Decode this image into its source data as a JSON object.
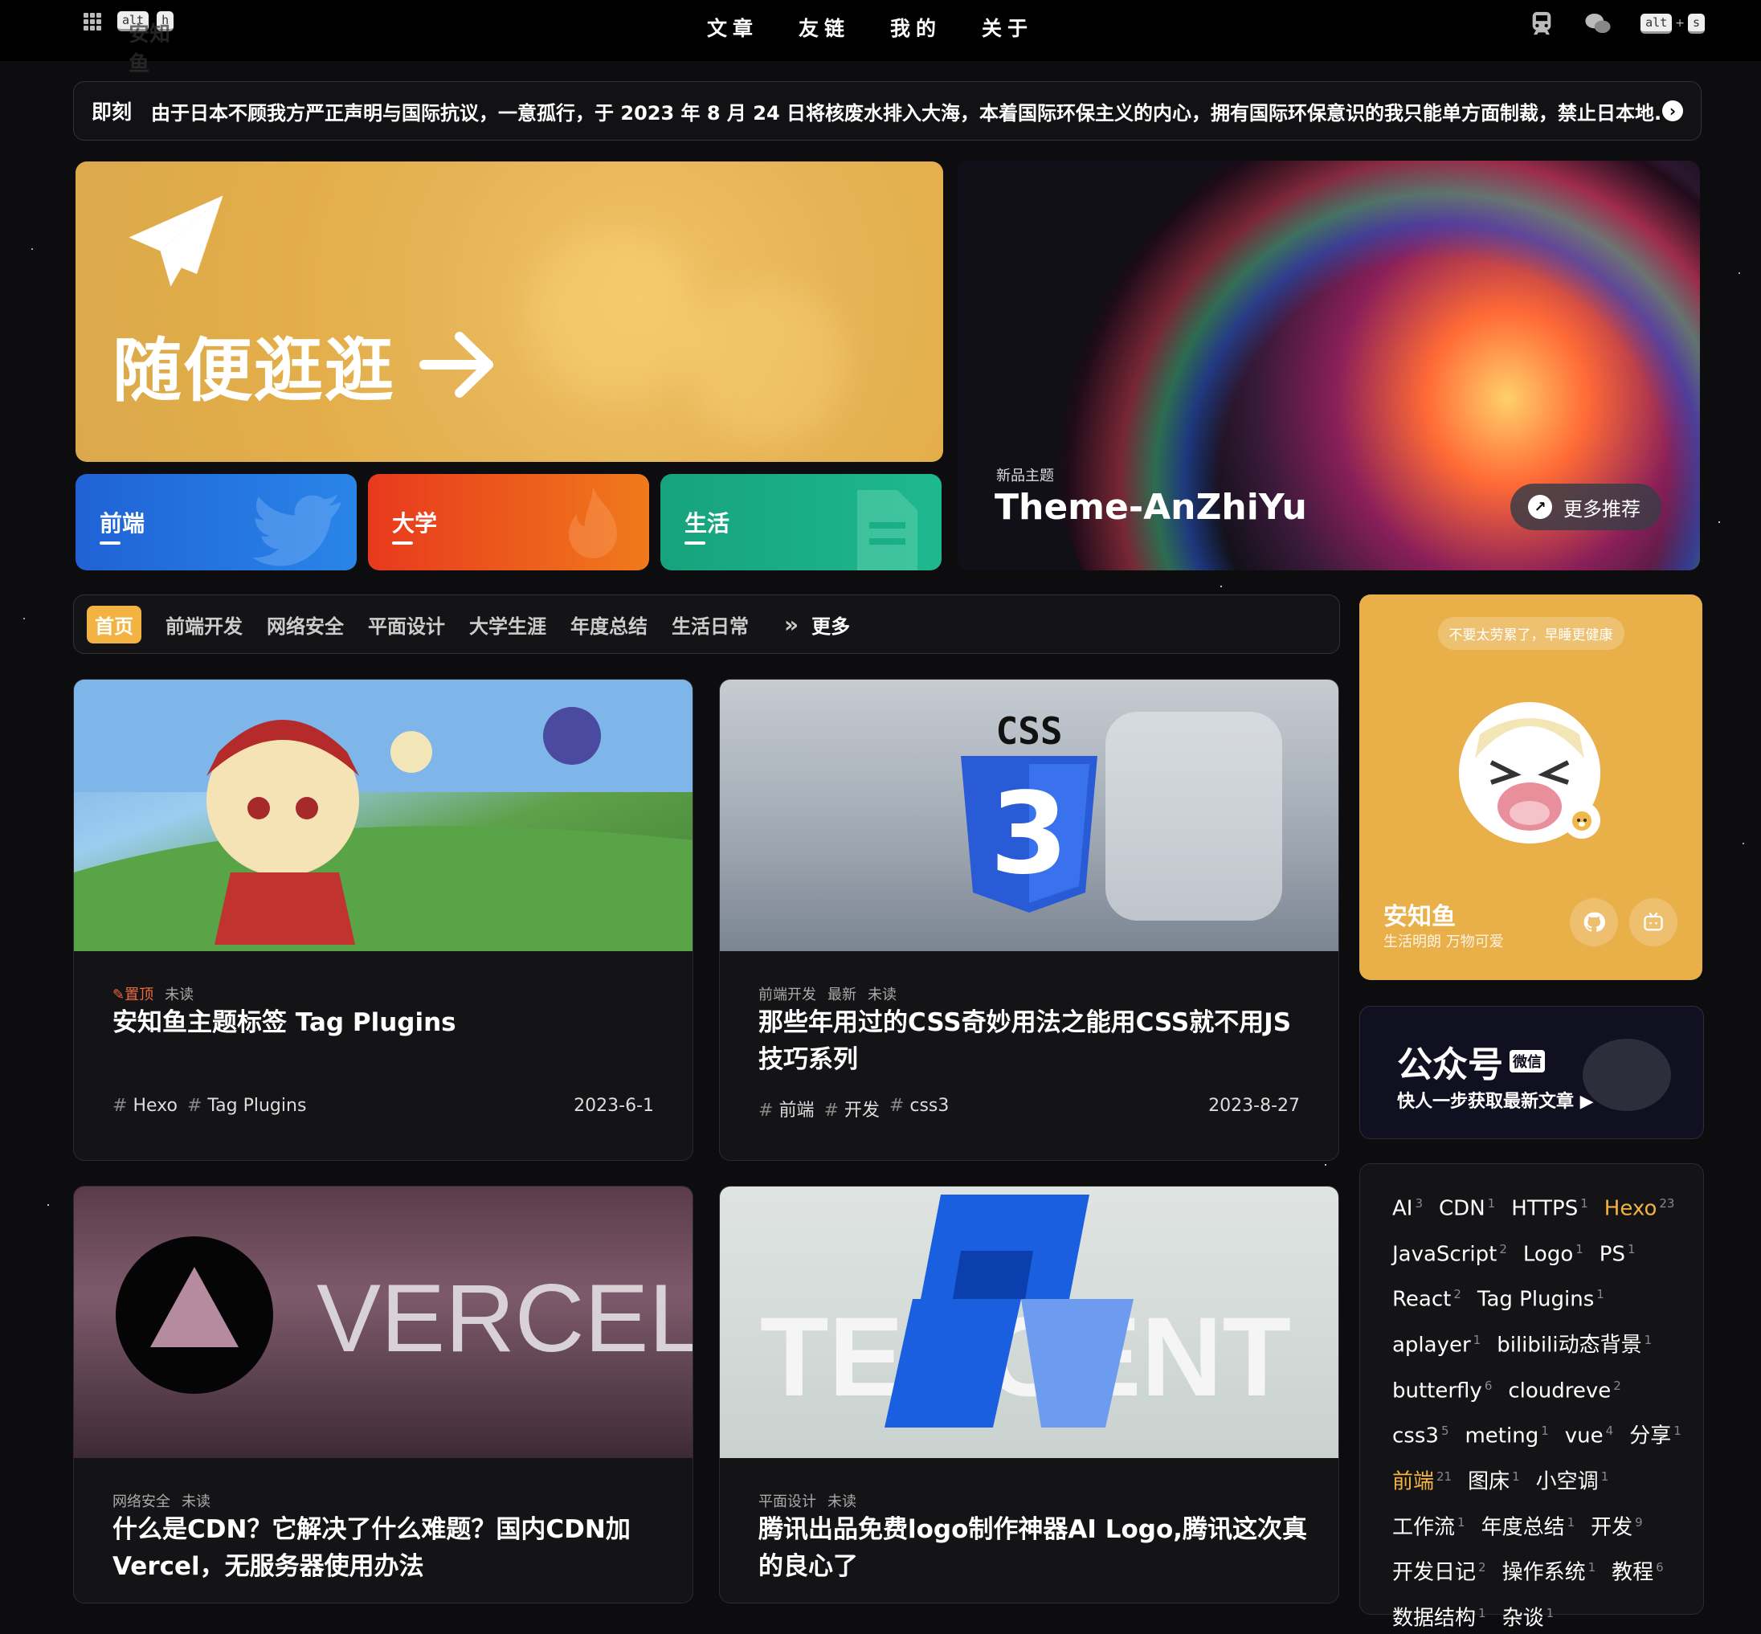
{
  "header": {
    "site_name": "安知鱼",
    "kbd_alt": "alt",
    "kbd_h": "h",
    "kbd_s": "s",
    "kbd_plus": "+",
    "nav": [
      "文章",
      "友链",
      "我的",
      "关于"
    ]
  },
  "bulletin": {
    "label": "即刻",
    "text": "由于日本不顾我方严正声明与国际抗议，一意孤行，于 2023 年 8 月 24 日将核废水排入大海，本着国际环保主义的内心，拥有国际环保意识的我只能单方面制裁，禁止日本地..."
  },
  "random": {
    "label": "随便逛逛"
  },
  "categories_tiles": [
    {
      "label": "前端",
      "color": "#1f62d6"
    },
    {
      "label": "大学",
      "color": "#e8391d"
    },
    {
      "label": "生活",
      "color": "#16a37d"
    }
  ],
  "banner": {
    "subtitle": "新品主题",
    "title": "Theme-AnZhiYu",
    "more_label": "更多推荐"
  },
  "category_bar": {
    "items": [
      "首页",
      "前端开发",
      "网络安全",
      "平面设计",
      "大学生涯",
      "年度总结",
      "生活日常"
    ],
    "more": "更多"
  },
  "posts": [
    {
      "pin": "置顶",
      "meta": [
        "未读"
      ],
      "title": "安知鱼主题标签 Tag Plugins",
      "tags": [
        "Hexo",
        "Tag Plugins"
      ],
      "date": "2023-6-1"
    },
    {
      "meta": [
        "前端开发",
        "最新",
        "未读"
      ],
      "title": "那些年用过的CSS奇妙用法之能用CSS就不用JS技巧系列",
      "tags": [
        "前端",
        "开发",
        "css3"
      ],
      "date": "2023-8-27"
    },
    {
      "meta": [
        "网络安全",
        "未读"
      ],
      "title": "什么是CDN？它解决了什么难题？国内CDN加Vercel，无服务器使用办法"
    },
    {
      "meta": [
        "平面设计",
        "未读"
      ],
      "title": "腾讯出品免费logo制作神器AI Logo,腾讯这次真的良心了"
    }
  ],
  "covers": {
    "css_label": "CSS",
    "css_number": "3",
    "vercel_label": "VERCEL",
    "tencent_label": "TENCENT"
  },
  "author": {
    "tip": "不要太劳累了，早睡更健康",
    "name": "安知鱼",
    "desc": "生活明朗 万物可爱"
  },
  "wechat": {
    "title": "公众号",
    "badge": "微信",
    "subtitle": "快人一步获取最新文章 ▶"
  },
  "tags": [
    {
      "name": "AI",
      "count": "3"
    },
    {
      "name": "CDN",
      "count": "1"
    },
    {
      "name": "HTTPS",
      "count": "1"
    },
    {
      "name": "Hexo",
      "count": "23",
      "highlight": true
    },
    {
      "name": "JavaScript",
      "count": "2"
    },
    {
      "name": "Logo",
      "count": "1"
    },
    {
      "name": "PS",
      "count": "1"
    },
    {
      "name": "React",
      "count": "2"
    },
    {
      "name": "Tag Plugins",
      "count": "1"
    },
    {
      "name": "aplayer",
      "count": "1"
    },
    {
      "name": "bilibili动态背景",
      "count": "1"
    },
    {
      "name": "butterfly",
      "count": "6"
    },
    {
      "name": "cloudreve",
      "count": "2"
    },
    {
      "name": "css3",
      "count": "5"
    },
    {
      "name": "meting",
      "count": "1"
    },
    {
      "name": "vue",
      "count": "4"
    },
    {
      "name": "分享",
      "count": "1"
    },
    {
      "name": "前端",
      "count": "21",
      "highlight": true
    },
    {
      "name": "图床",
      "count": "1"
    },
    {
      "name": "小空调",
      "count": "1"
    },
    {
      "name": "工作流",
      "count": "1"
    },
    {
      "name": "年度总结",
      "count": "1"
    },
    {
      "name": "开发",
      "count": "9"
    },
    {
      "name": "开发日记",
      "count": "2"
    },
    {
      "name": "操作系统",
      "count": "1"
    },
    {
      "name": "教程",
      "count": "6"
    },
    {
      "name": "数据结构",
      "count": "1"
    },
    {
      "name": "杂谈",
      "count": "1"
    }
  ],
  "colors": {
    "accent": "#f2b342",
    "background": "#0d0d10"
  }
}
